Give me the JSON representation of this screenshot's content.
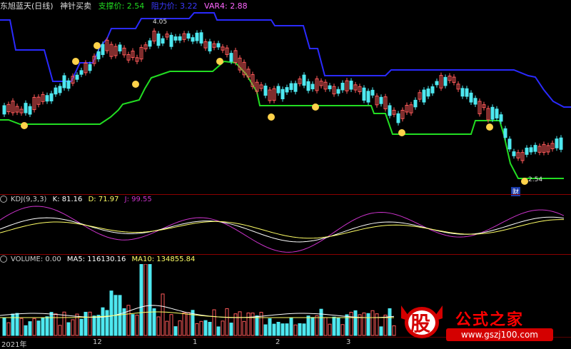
{
  "header": {
    "stock_title": "东旭蓝天(日线)",
    "indicator_name": "神针买卖",
    "support_label": "支撑价: 2.54",
    "resist_label": "阻力价: 3.22",
    "var4_label": "VAR4: 2.88"
  },
  "price_panel": {
    "high_marker": "4.05",
    "low_marker": "2.54",
    "event_badge": "财"
  },
  "kdj_panel": {
    "title": "KDJ(9,3,3)",
    "k": "K: 81.16",
    "d": "D: 71.97",
    "j": "J: 99.55"
  },
  "volume_panel": {
    "title": "VOLUME: 0.00",
    "ma5": "MA5: 116130.16",
    "ma10": "MA10: 134855.84"
  },
  "time_axis": {
    "labels": [
      "2021年",
      "12",
      "1",
      "2",
      "3"
    ]
  },
  "watermark": {
    "logo_char": "股",
    "site_name": "公式之家",
    "url": "www.gszj100.com"
  },
  "colors": {
    "up": "#ff5a5a",
    "down": "#4ee8f0",
    "resistance": "#2a2aff",
    "support": "#22dd22",
    "k_line": "#ffffff",
    "d_line": "#ffff66",
    "j_line": "#cc33cc",
    "separator": "#8b0000",
    "watermark": "#d40000"
  }
}
